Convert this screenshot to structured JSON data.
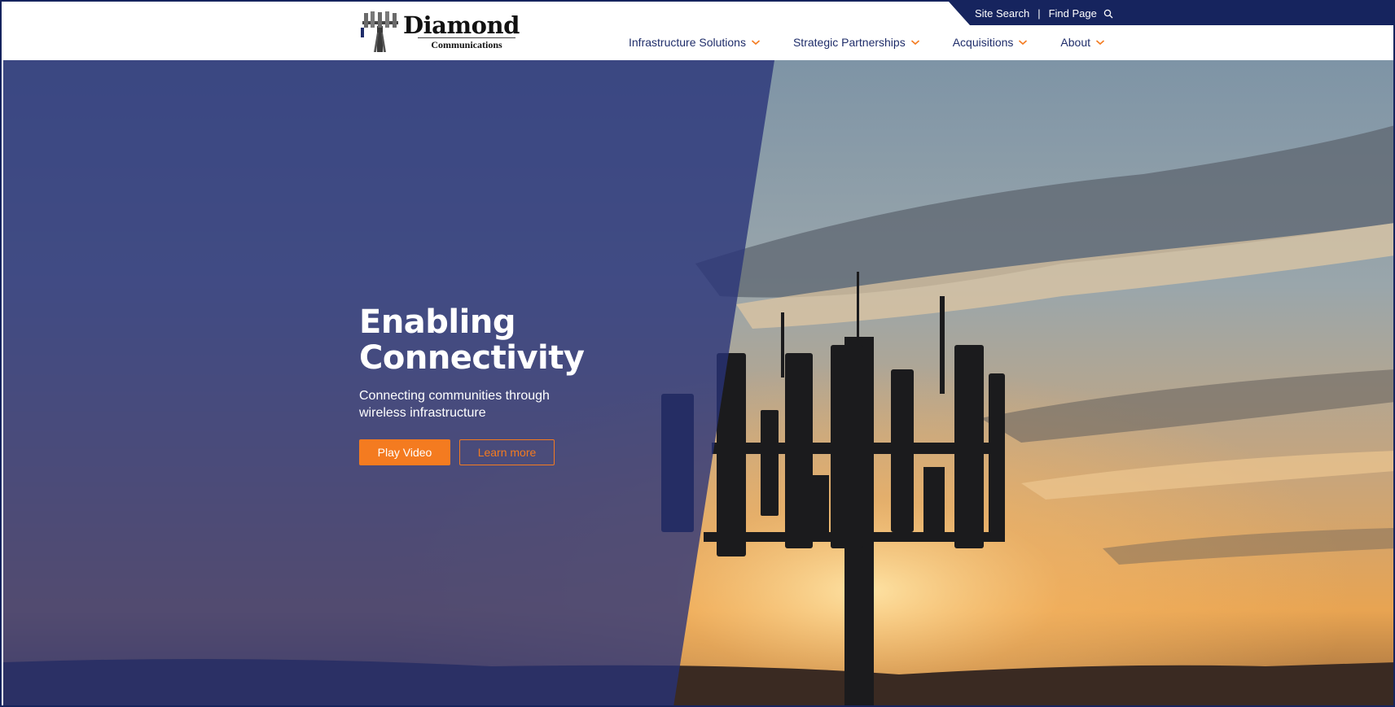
{
  "brand": {
    "name": "Diamond",
    "subtitle": "Communications"
  },
  "utility": {
    "site_search": "Site Search",
    "separator": "|",
    "find_page": "Find Page",
    "search_icon": "search-icon"
  },
  "nav": {
    "items": [
      {
        "label": "Infrastructure Solutions"
      },
      {
        "label": "Strategic Partnerships"
      },
      {
        "label": "Acquisitions"
      },
      {
        "label": "About"
      }
    ],
    "chevron_icon": "chevron-down-icon"
  },
  "hero": {
    "title_line1": "Enabling",
    "title_line2": "Connectivity",
    "subtitle": "Connecting communities through wireless infrastructure",
    "primary_button": "Play Video",
    "secondary_button": "Learn more"
  },
  "colors": {
    "navy": "#16245e",
    "accent_orange": "#f47b20",
    "nav_text": "#1f2d6a",
    "overlay": "#28327a"
  }
}
